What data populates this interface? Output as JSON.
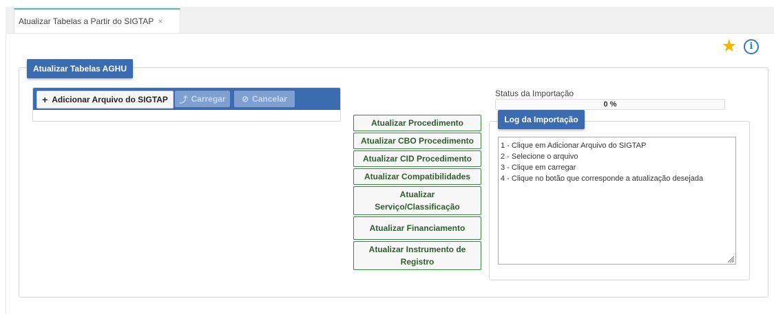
{
  "tab": {
    "label": "Atualizar Tabelas a Partir do SIGTAP",
    "close": "×"
  },
  "icons": {
    "favorite": "star-icon",
    "info": "info-icon",
    "info_glyph": "i"
  },
  "main": {
    "legend": "Atualizar Tabelas AGHU"
  },
  "upload": {
    "add_label": "Adicionar Arquivo do SIGTAP",
    "add_glyph": "+",
    "load_label": "Carregar",
    "load_glyph": "⤴",
    "cancel_label": "Cancelar",
    "cancel_glyph": "⊘"
  },
  "actions": [
    {
      "label": "Atualizar Procedimento"
    },
    {
      "label": "Atualizar CBO Procedimento"
    },
    {
      "label": "Atualizar CID Procedimento"
    },
    {
      "label": "Atualizar Compatibilidades"
    },
    {
      "label": "Atualizar Serviço/Classificação"
    },
    {
      "label": "Atualizar Financiamento"
    },
    {
      "label": "Atualizar Instrumento de Registro"
    }
  ],
  "status": {
    "label": "Status da Importação",
    "progress_text": "0 %",
    "progress_value": 0
  },
  "log": {
    "legend": "Log da Importação",
    "lines": [
      "1 - Clique em Adicionar Arquivo do SIGTAP",
      "2 - Selecione o arquivo",
      "3 - Clique em carregar",
      "4 - Clique no botão que corresponde a atualização desejada"
    ]
  },
  "colors": {
    "accent_blue": "#3b6cb0",
    "button_green_border": "#2e8b3a",
    "star_gold": "#f5b400",
    "tab_accent": "#5bb5a8"
  }
}
